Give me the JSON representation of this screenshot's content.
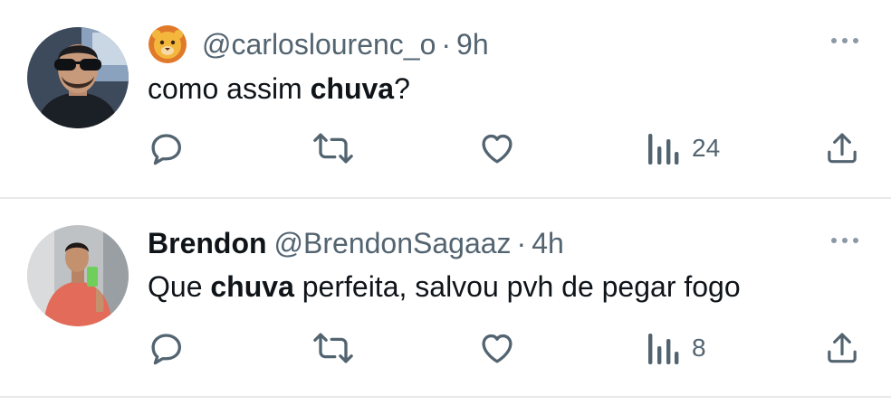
{
  "tweets": [
    {
      "display_name": "",
      "handle": "@carloslourenc_o",
      "time": "9h",
      "badge": "lion-face-emoji",
      "text_before": "como assim ",
      "text_bold": "chuva",
      "text_after": "?",
      "views": "24"
    },
    {
      "display_name": "Brendon",
      "handle": "@BrendonSagaaz",
      "time": "4h",
      "text_before": "Que ",
      "text_bold": "chuva",
      "text_after": " perfeita, salvou pvh de pegar fogo",
      "views": "8"
    }
  ],
  "icons": {
    "reply": "reply-icon",
    "retweet": "retweet-icon",
    "like": "heart-icon",
    "views": "views-icon",
    "share": "share-icon",
    "more": "more-icon"
  },
  "colors": {
    "text": "#0f1419",
    "secondary": "#536471",
    "divider": "#e7e9eb"
  }
}
